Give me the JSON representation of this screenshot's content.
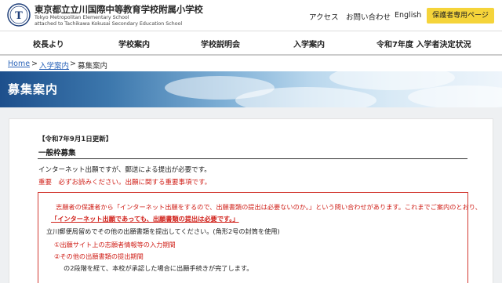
{
  "header": {
    "logo_text": "T",
    "school_name_ja": "東京都立立川国際中等教育学校附属小学校",
    "school_name_en_line1": "Tokyo Metropolitan Elementary School",
    "school_name_en_line2": "attached to Tachikawa Kokusai Secondary Education School",
    "links": [
      "アクセス",
      "お問い合わせ",
      "English"
    ],
    "guardian_button": "保護者専用ページ",
    "accent_color": "#f5d43a"
  },
  "nav": {
    "items": [
      "校長より",
      "学校案内",
      "学校説明会",
      "入学案内",
      "令和7年度 入学者決定状況"
    ]
  },
  "breadcrumb": {
    "home": "Home",
    "sep": ">",
    "parent": "入学案内",
    "current": "募集案内"
  },
  "page": {
    "title": "募集案内"
  },
  "content": {
    "updated": "【令和7年9月1日更新】",
    "section_heading": "一般枠募集",
    "intro": "インターネット出願ですが、郵送による提出が必要です。",
    "important": "重要　必ずお読みください。出願に関する重要事項です。",
    "notice": {
      "line1": "志願者の保護者から「インターネット出願をするので、出願書類の提出は必要ないのか。」という問い合わせがあります。これまでご案内のとおり、",
      "line2": "「インターネット出願であっても、出願書類の提出は必要です。」",
      "line3": "立川郵便局留めでその他の出願書類を提出してください。(角形2号の封筒を使用)",
      "line4": "①出願サイト上の志願者情報等の入力期間",
      "line5": "②その他の出願書類の提出期間",
      "line6": "の2段階を経て、本校が承認した場合に出願手続きが完了します。"
    },
    "warning_color": "#d0211a"
  }
}
